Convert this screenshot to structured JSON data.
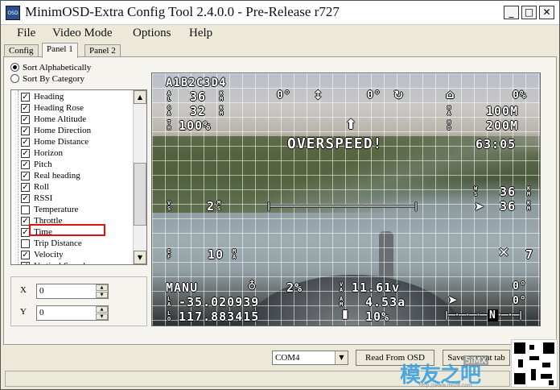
{
  "window": {
    "title": "MinimOSD-Extra Config Tool 2.4.0.0 - Pre-Release r727",
    "icon_label": "OSD",
    "minimize": "_",
    "maximize": "□",
    "close": "✕"
  },
  "menu": [
    "File",
    "Video Mode",
    "Options",
    "Help"
  ],
  "tabs": [
    "Config",
    "Panel 1",
    "Panel 2"
  ],
  "sort_options": [
    {
      "label": "Sort Alphabetically",
      "selected": true
    },
    {
      "label": "Sort By Category",
      "selected": false
    }
  ],
  "panel_items": [
    {
      "label": "Heading",
      "checked": true
    },
    {
      "label": "Heading Rose",
      "checked": true
    },
    {
      "label": "Home Altitude",
      "checked": true
    },
    {
      "label": "Home Direction",
      "checked": true
    },
    {
      "label": "Home Distance",
      "checked": true
    },
    {
      "label": "Horizon",
      "checked": true
    },
    {
      "label": "Pitch",
      "checked": true
    },
    {
      "label": "Real heading",
      "checked": true
    },
    {
      "label": "Roll",
      "checked": true
    },
    {
      "label": "RSSI",
      "checked": true
    },
    {
      "label": "Temperature",
      "checked": false
    },
    {
      "label": "Throttle",
      "checked": true
    },
    {
      "label": "Time",
      "checked": true
    },
    {
      "label": "Trip Distance",
      "checked": false
    },
    {
      "label": "Velocity",
      "checked": true
    },
    {
      "label": "Vertical Speed",
      "checked": true
    }
  ],
  "position": {
    "x_label": "X",
    "y_label": "Y",
    "x_value": "0",
    "y_value": "0"
  },
  "osd": {
    "top_left_label": "A1B2C3D4",
    "alt_value": "36",
    "ga_value": "32",
    "throttle_value": "100%",
    "pitch_value": "0°",
    "roll_value": "0°",
    "battery_pct_top": "0%",
    "home_alt": "100M",
    "home_dist": "200M",
    "warning": "OVERSPEED!",
    "timer": "63:05",
    "ws_value": "36",
    "speed_value": "36",
    "vs_value": "2",
    "ef_value": "10",
    "sats_value": "7",
    "mode": "MANU",
    "rssi_value": "2%",
    "voltage": "11.61v",
    "current": "4.53a",
    "lat": "-35.020939",
    "lon": "117.883415",
    "battery_remaining": "10%",
    "heading_top": "0°",
    "heading_bottom": "0°",
    "compass_letter": "N"
  },
  "bottom": {
    "com_port": "COM4",
    "read_button": "Read From OSD",
    "save_button": "Save current tab"
  },
  "watermark": {
    "text": "模友之吧",
    "sub": "5iMX",
    "url": "http://www.moz8.com"
  },
  "colors": {
    "highlight": "#e01010",
    "window_bg": "#ece9d8",
    "watermark": "#3aa0e0"
  }
}
